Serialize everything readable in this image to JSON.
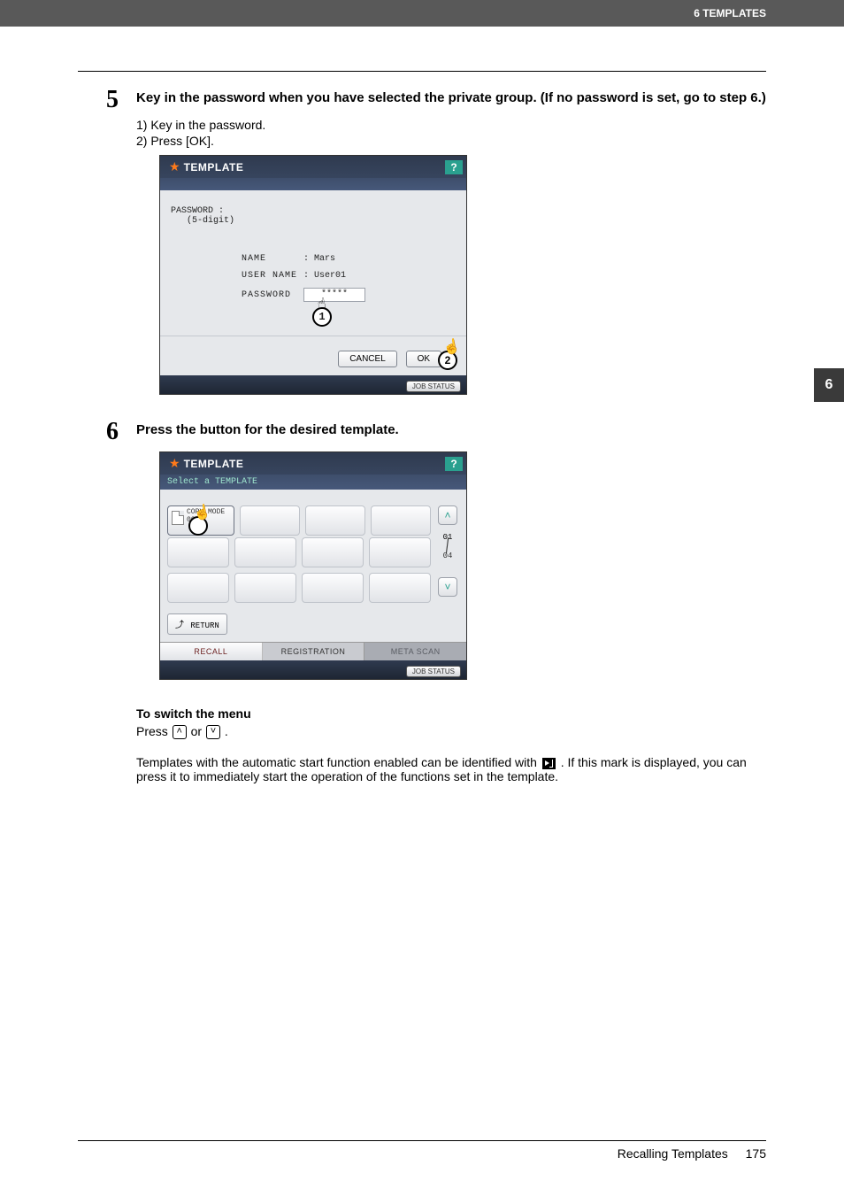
{
  "header": {
    "chapter_title": "6 TEMPLATES"
  },
  "chapter_tab": "6",
  "step5": {
    "number": "5",
    "title": "Key in the password when you have selected the private group. (If no password is set, go to step 6.)",
    "sub1": "1)  Key in the password.",
    "sub2": "2)  Press [OK]."
  },
  "screen1": {
    "panel_title": "TEMPLATE",
    "help": "?",
    "pw_label1": "PASSWORD :",
    "pw_label2": "(5-digit)",
    "name_k": "NAME",
    "name_v": ": Mars",
    "user_k": "USER NAME",
    "user_v": ": User01",
    "pass_k": "PASSWORD",
    "pass_v": "*****",
    "callout1": "1",
    "cancel": "CANCEL",
    "ok": "OK",
    "callout2": "2",
    "job_status": "JOB STATUS"
  },
  "step6": {
    "number": "6",
    "title": "Press the button for the desired template."
  },
  "screen2": {
    "panel_title": "TEMPLATE",
    "subtitle": "Select a TEMPLATE",
    "help": "?",
    "tile_line1": "COPY MODE",
    "tile_line2": "002",
    "page_cur": "01",
    "page_tot": "04",
    "return": "RETURN",
    "tab_recall": "RECALL",
    "tab_reg": "REGISTRATION",
    "tab_meta": "META SCAN",
    "job_status": "JOB STATUS"
  },
  "post": {
    "switch_h": "To switch the menu",
    "switch_pre": "Press ",
    "switch_or": " or ",
    "switch_end": ".",
    "auto_pre": "Templates with the automatic start function enabled can be identified with ",
    "auto_post": ". If this mark is displayed, you can press it to immediately start the operation of the functions set in the template."
  },
  "footer": {
    "section": "Recalling Templates",
    "page": "175"
  }
}
